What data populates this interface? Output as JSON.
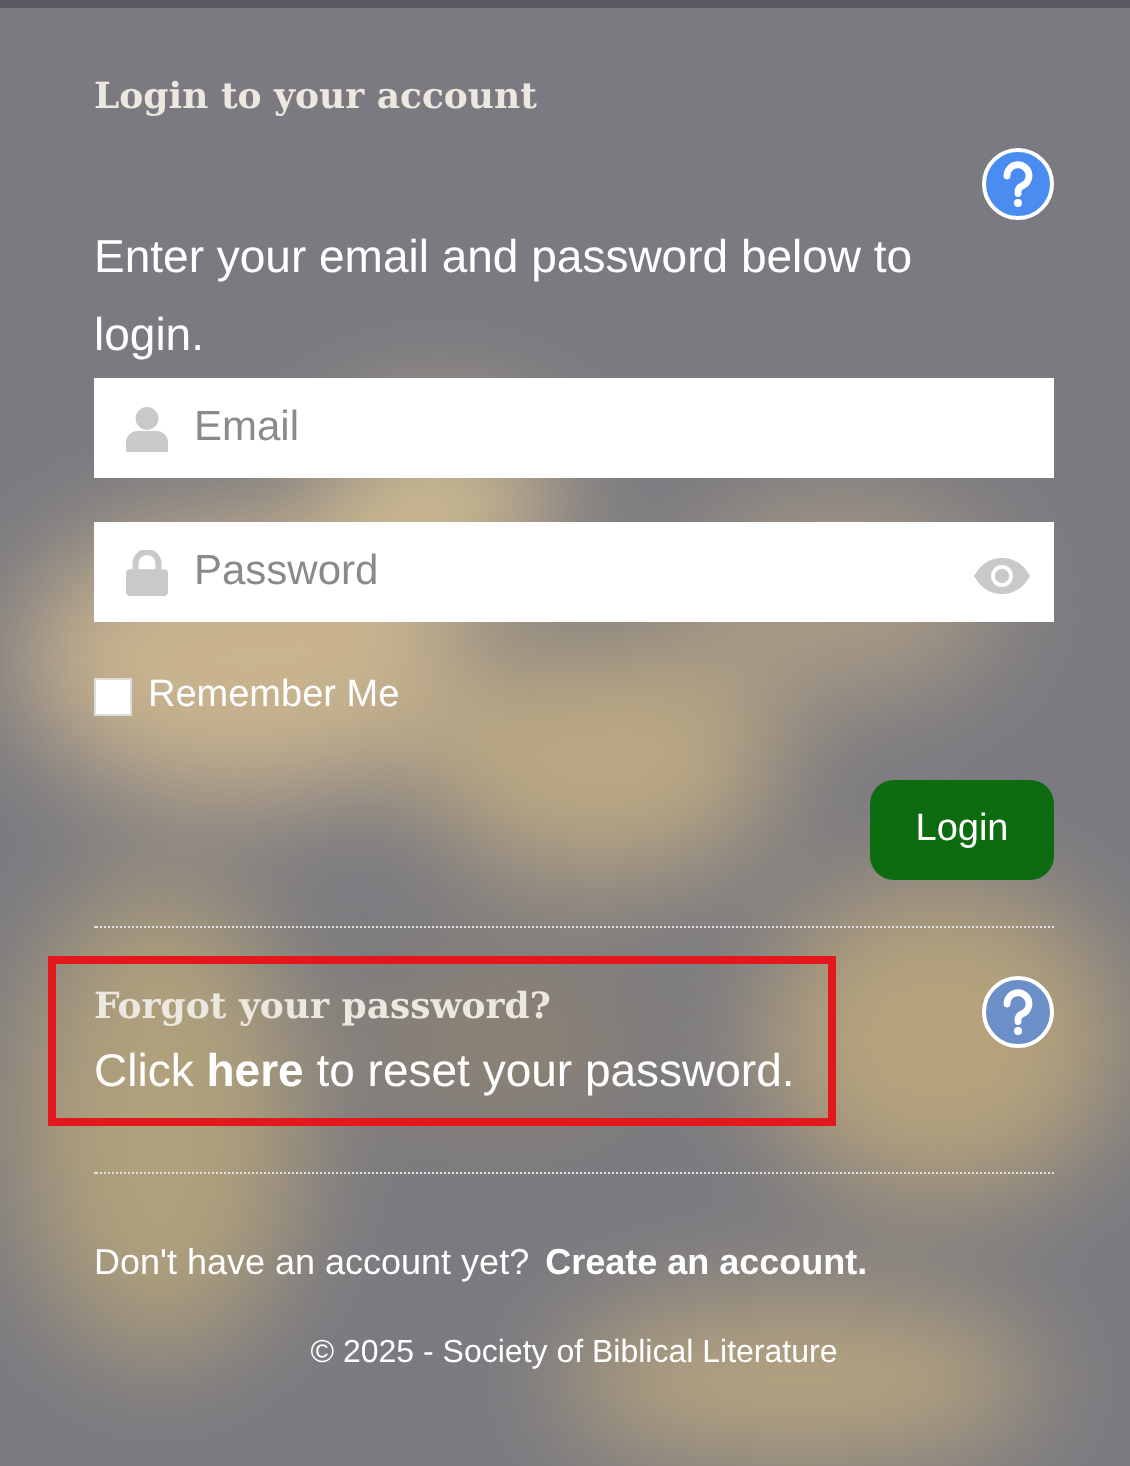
{
  "heading": "Login to your account",
  "instructions": "Enter your email and password below to login.",
  "fields": [
    {
      "kind": "email",
      "placeholder": "Email"
    },
    {
      "kind": "password",
      "placeholder": "Password"
    }
  ],
  "remember": {
    "label": "Remember Me",
    "checked": false
  },
  "login_button": "Login",
  "forgot": {
    "title": "Forgot your password?",
    "before": "Click",
    "link": "here",
    "after": "to reset your password.",
    "highlighted": true
  },
  "signup": {
    "prompt": "Don't have an account yet?",
    "link": "Create an account."
  },
  "footer": "© 2025 - Society of Biblical Literature"
}
